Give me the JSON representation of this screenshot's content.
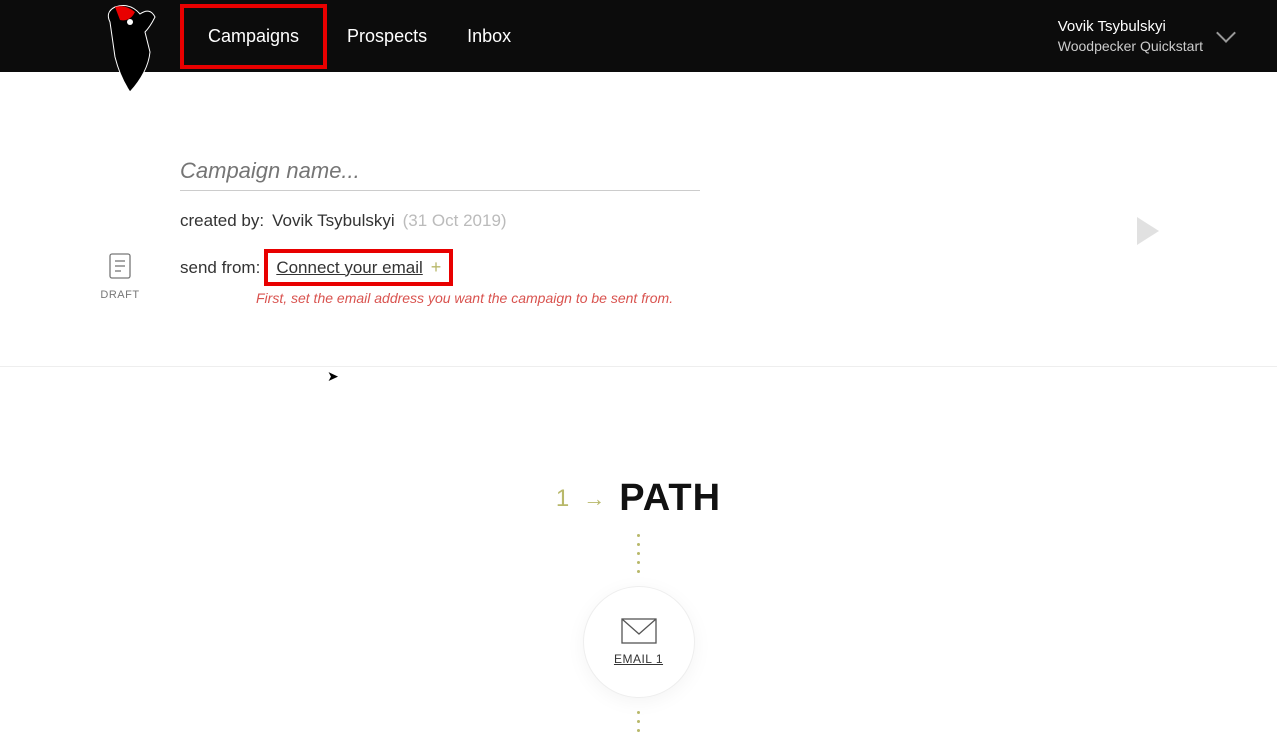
{
  "nav": {
    "campaigns": "Campaigns",
    "prospects": "Prospects",
    "inbox": "Inbox"
  },
  "user": {
    "name": "Vovik Tsybulskyi",
    "org": "Woodpecker Quickstart"
  },
  "draft": {
    "label": "DRAFT"
  },
  "campaign": {
    "placeholder": "Campaign name...",
    "created_by_label": "created by:",
    "created_by_value": "Vovik Tsybulskyi",
    "created_date": "(31 Oct 2019)",
    "send_from_label": "send from:",
    "connect_label": "Connect your email",
    "helper": "First, set the email address you want the campaign to be sent from."
  },
  "path": {
    "num": "1",
    "arrow": "→",
    "title": "PATH",
    "email_label": "EMAIL 1"
  }
}
